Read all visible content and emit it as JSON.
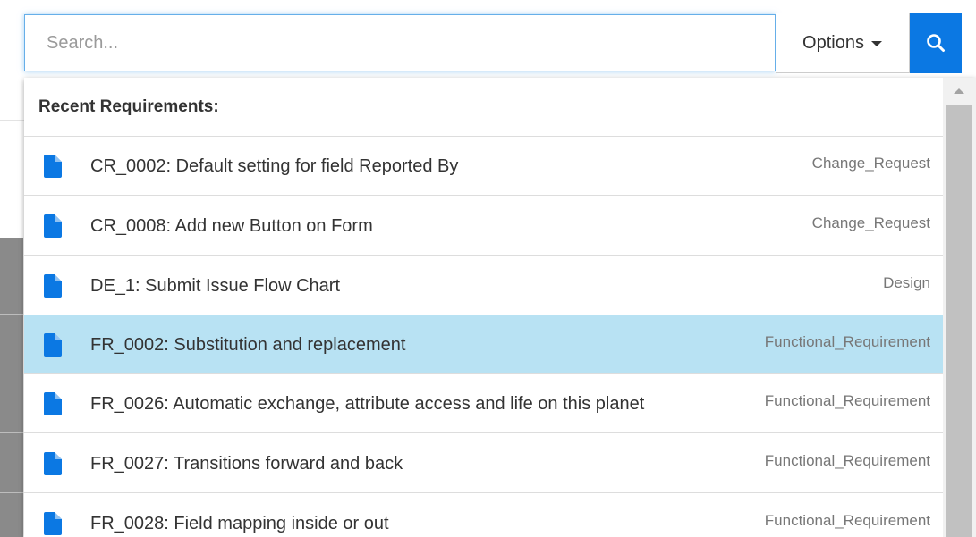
{
  "search": {
    "placeholder": "Search...",
    "value": ""
  },
  "options": {
    "label": "Options"
  },
  "search_button": {
    "icon": "search-icon",
    "color": "#0b78e3"
  },
  "dropdown": {
    "header": "Recent Requirements:",
    "selected_index": 3,
    "items": [
      {
        "title": "CR_0002: Default setting for field Reported By",
        "type": "Change_Request",
        "icon": "document-icon"
      },
      {
        "title": "CR_0008: Add new Button on Form",
        "type": "Change_Request",
        "icon": "document-icon"
      },
      {
        "title": "DE_1: Submit Issue Flow Chart",
        "type": "Design",
        "icon": "document-icon"
      },
      {
        "title": "FR_0002: Substitution and replacement",
        "type": "Functional_Requirement",
        "icon": "document-icon"
      },
      {
        "title": "FR_0026: Automatic exchange, attribute access and life on this planet",
        "type": "Functional_Requirement",
        "icon": "document-icon"
      },
      {
        "title": "FR_0027: Transitions forward and back",
        "type": "Functional_Requirement",
        "icon": "document-icon"
      },
      {
        "title": "FR_0028: Field mapping inside or out",
        "type": "Functional_Requirement",
        "icon": "document-icon"
      }
    ]
  },
  "colors": {
    "accent": "#0b78e3",
    "selected_row": "#b8e2f3",
    "focus_border": "#66afe9"
  }
}
